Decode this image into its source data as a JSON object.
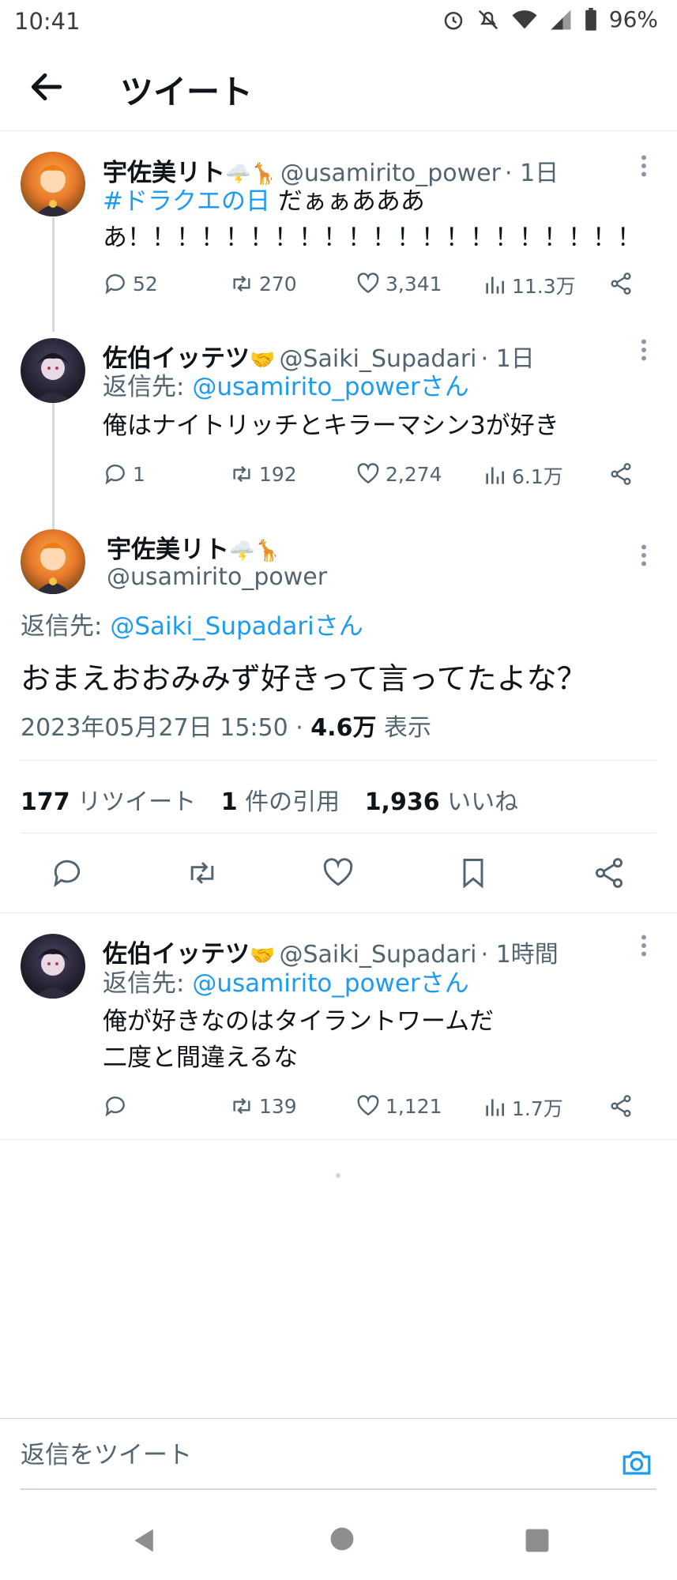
{
  "status_bar": {
    "time": "10:41",
    "battery": "96%"
  },
  "header": {
    "title": "ツイート"
  },
  "tweet1": {
    "name": "宇佐美リト",
    "name_emoji": "🌩️🦒",
    "handle": "@usamirito_power",
    "time": "· 1日",
    "hashtag": "#ドラクエの日",
    "text_line1": " だぁぁあああ",
    "text_line2": "あ！！！！！！！！！！！！！！！！！！！！！",
    "replies": "52",
    "retweets": "270",
    "likes": "3,341",
    "views": "11.3万"
  },
  "tweet2": {
    "name": "佐伯イッテツ",
    "name_emoji": "🤝",
    "handle": "@Saiki_Supadari",
    "time": "· 1日",
    "reply_prefix": "返信先: ",
    "reply_to": "@usamirito_powerさん",
    "text": "俺はナイトリッチとキラーマシン3が好き",
    "replies": "1",
    "retweets": "192",
    "likes": "2,274",
    "views": "6.1万"
  },
  "main_tweet": {
    "name": "宇佐美リト",
    "name_emoji": "🌩️🦒",
    "handle": "@usamirito_power",
    "reply_prefix": "返信先: ",
    "reply_to": "@Saiki_Supadariさん",
    "text": "おまえおおみみず好きって言ってたよな？",
    "datetime": "2023年05月27日 15:50 · ",
    "views_num": "4.6万",
    "views_label": " 表示",
    "retweets_num": "177",
    "retweets_label": " リツイート",
    "quotes_num": "1",
    "quotes_label": " 件の引用",
    "likes_num": "1,936",
    "likes_label": " いいね"
  },
  "tweet3": {
    "name": "佐伯イッテツ",
    "name_emoji": "🤝",
    "handle": "@Saiki_Supadari",
    "time": "· 1時間",
    "reply_prefix": "返信先: ",
    "reply_to": "@usamirito_powerさん",
    "text_line1": "俺が好きなのはタイラントワームだ",
    "text_line2": "二度と間違えるな",
    "replies": "",
    "retweets": "139",
    "likes": "1,121",
    "views": "1.7万"
  },
  "reply_box": {
    "placeholder": "返信をツイート"
  },
  "colors": {
    "accent": "#1d9bf0",
    "muted": "#536471",
    "text": "#0f1419"
  }
}
